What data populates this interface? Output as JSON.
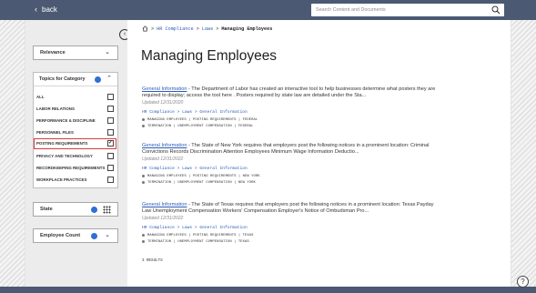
{
  "topbar": {
    "back_label": "back",
    "search_placeholder": "Search Content and Documents"
  },
  "breadcrumb": {
    "items": [
      "HR Compliance",
      "Laws"
    ],
    "current": "Managing Employees"
  },
  "page_title": "Managing Employees",
  "sidebar": {
    "sort_label": "Relevance",
    "topics": {
      "title": "Topics for Category",
      "options": [
        {
          "label": "ALL",
          "checked": false
        },
        {
          "label": "LABOR RELATIONS",
          "checked": false
        },
        {
          "label": "PERFORMANCE & DISCIPLINE",
          "checked": false
        },
        {
          "label": "PERSONNEL FILES",
          "checked": false
        },
        {
          "label": "POSTING REQUIREMENTS",
          "checked": true
        },
        {
          "label": "PRIVACY AND TECHNOLOGY",
          "checked": false
        },
        {
          "label": "RECORDKEEPING REQUIREMENTS",
          "checked": false
        },
        {
          "label": "WORKPLACE PRACTICES",
          "checked": false
        }
      ],
      "checkmark": "✓"
    },
    "state_label": "State",
    "employee_count_label": "Employee Count"
  },
  "results": [
    {
      "source": "General Information",
      "text": " - The Department of Labor has created an interactive tool to help businesses determine what posters they are required to display; access the tool here . Posters required by state law are detailed under the Sta...",
      "updated": "Updated 12/31/2020",
      "crumb": "HR Compliance > Laws > General Information",
      "tags_line1": "MANAGING EMPLOYEES | POSTING REQUIREMENTS | FEDERAL",
      "tags_line2": "TERMINATION | UNEMPLOYMENT COMPENSATION | FEDERAL"
    },
    {
      "source": "General Information",
      "text": " - The State of New York requires that employers post the following notices in a prominent location: Criminal Convictions Records Discrimination Attention Employees Minimum Wage Information Deductio...",
      "updated": "Updated 12/31/2022",
      "crumb": "HR Compliance > Laws > General Information",
      "tags_line1": "MANAGING EMPLOYEES | POSTING REQUIREMENTS | NEW YORK",
      "tags_line2": "TERMINATION | UNEMPLOYMENT COMPENSATION | NEW YORK"
    },
    {
      "source": "General Information",
      "text": " - The State of Texas requires that employers post the following notices in a prominent location: Texas Payday Law Unemployment Compensation Workers' Compensation Employer's Notice of Ombudsman Pro...",
      "updated": "Updated 12/31/2022",
      "crumb": "HR Compliance > Laws > General Information",
      "tags_line1": "MANAGING EMPLOYEES | POSTING REQUIREMENTS | TEXAS",
      "tags_line2": "TERMINATION | UNEMPLOYMENT COMPENSATION | TEXAS"
    }
  ],
  "result_count": "3 RESULTS",
  "help_label": "?",
  "colors": {
    "topbar": "#4b5a72",
    "link": "#2c5bb8",
    "badge": "#2f6fd6",
    "highlight": "#d63d3d"
  }
}
